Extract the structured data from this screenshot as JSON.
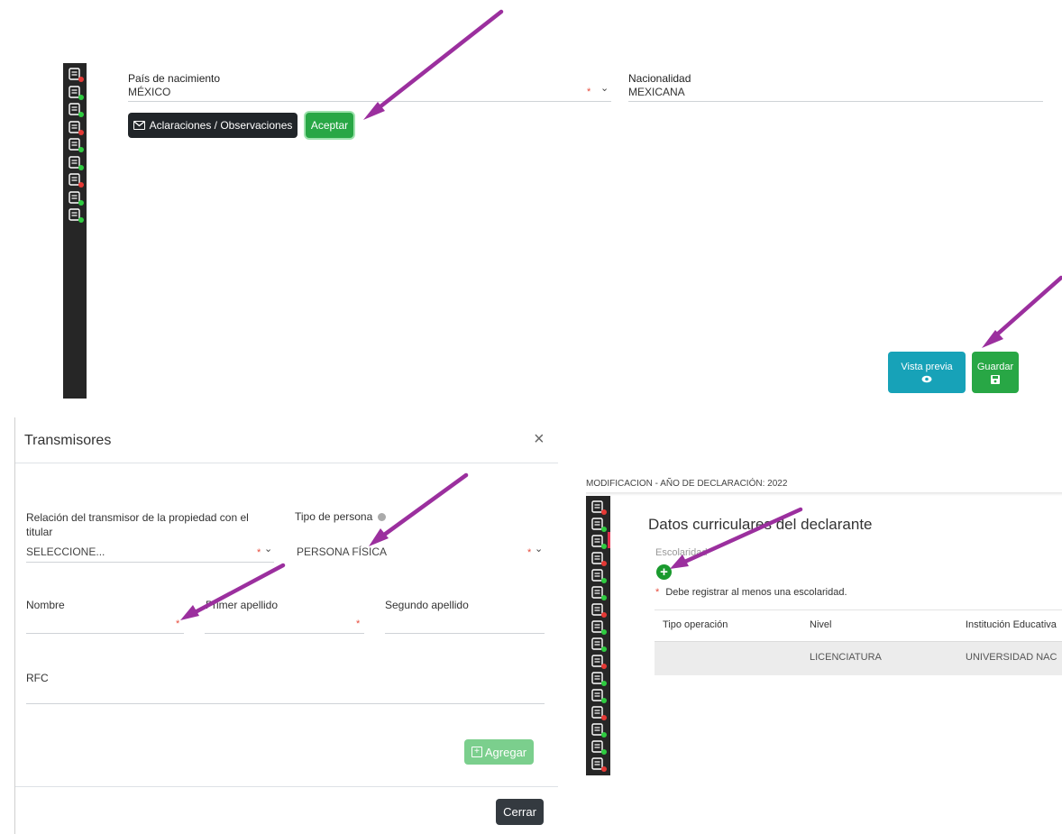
{
  "panel1": {
    "pais_label": "País de nacimiento",
    "pais_value": "MÉXICO",
    "required_mark": "*",
    "chevron": "⌄",
    "nacionalidad_label": "Nacionalidad",
    "nacionalidad_value": "MEXICANA",
    "aclaraciones_label": "Aclaraciones / Observaciones",
    "aceptar_label": "Aceptar",
    "vista_previa_label": "Vista previa",
    "guardar_label": "Guardar",
    "sidebar_icons": [
      "house-icon",
      "home-icon",
      "chart-icon",
      "people-tree-icon",
      "group-icon",
      "team-icon",
      "board-icon",
      "network-icon",
      "grid-icon"
    ]
  },
  "modal": {
    "title": "Transmisores",
    "close": "×",
    "relacion_label": "Relación del transmisor de la propiedad con el titular",
    "relacion_value": "SELECCIONE...",
    "tipo_label": "Tipo de persona",
    "tipo_value": "PERSONA FÍSICA",
    "nombre_label": "Nombre",
    "primer_label": "Primer apellido",
    "segundo_label": "Segundo apellido",
    "rfc_label": "RFC",
    "agregar_label": "Agregar",
    "cerrar_label": "Cerrar",
    "required_mark": "*",
    "chevron": "⌄"
  },
  "panel3": {
    "top_label": "MODIFICACION - AÑO DE DECLARACIÓN: 2022",
    "heading": "Datos curriculares del declarante",
    "escolaridad_label": "Escolaridad",
    "warning": "Debe registrar al menos una escolaridad.",
    "required_mark": "*",
    "columns": [
      "Tipo operación",
      "Nivel",
      "Institución Educativa"
    ],
    "rows": [
      [
        "",
        "LICENCIATURA",
        "UNIVERSIDAD NAC"
      ]
    ]
  },
  "colors": {
    "accent_green": "#28a745",
    "teal": "#17a2b8",
    "dark": "#212529",
    "arrow_purple": "#9b2f9e",
    "sidebar": "#262626"
  }
}
